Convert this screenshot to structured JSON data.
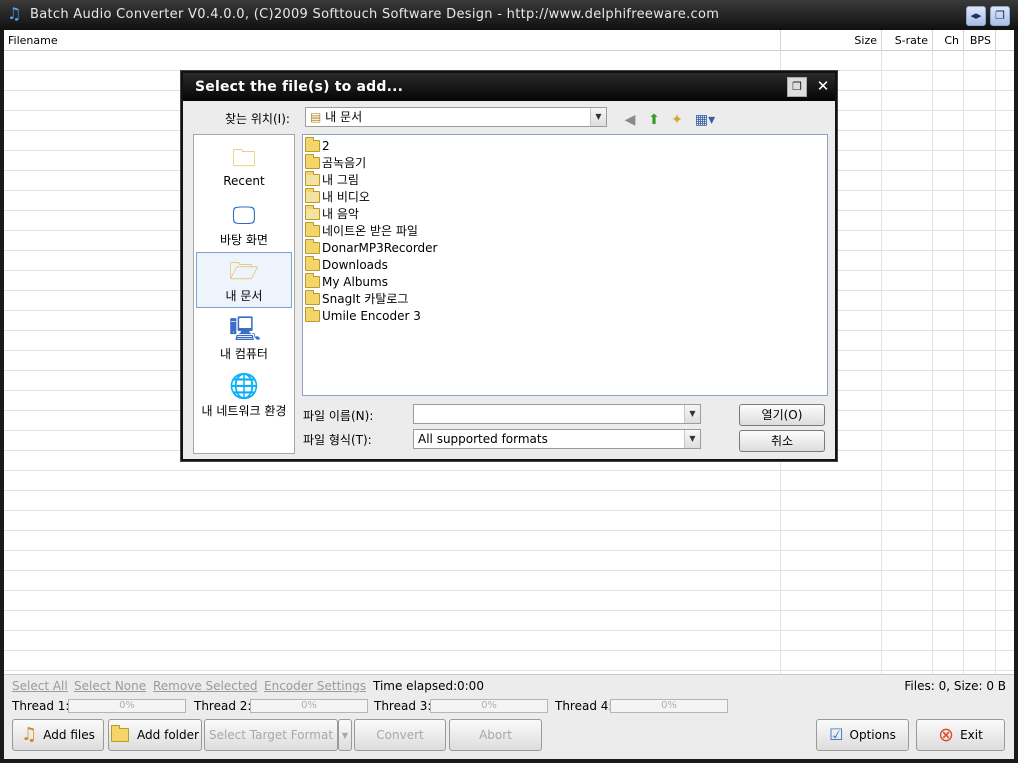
{
  "app": {
    "title": "Batch Audio Converter V0.4.0.0, (C)2009 Softtouch Software Design - http://www.delphifreeware.com",
    "icon": "music-note-icon"
  },
  "grid": {
    "columns": [
      "Filename",
      "Size",
      "S-rate",
      "Ch",
      "BPS"
    ]
  },
  "dialog": {
    "title": "Select the file(s) to add...",
    "lookin_label": "찾는 위치(I):",
    "lookin_value": "내 문서",
    "places": [
      "Recent",
      "바탕 화면",
      "내 문서",
      "내 컴퓨터",
      "내 네트워크 환경"
    ],
    "items": [
      "2",
      "곰녹음기",
      "내 그림",
      "내 비디오",
      "내 음악",
      "네이트온 받은 파일",
      "DonarMP3Recorder",
      "Downloads",
      "My Albums",
      "SnagIt 카탈로그",
      "Umile Encoder 3"
    ],
    "filename_label": "파일 이름(N):",
    "filename_value": "",
    "filetype_label": "파일 형식(T):",
    "filetype_value": "All supported formats",
    "open_label": "열기(O)",
    "cancel_label": "취소"
  },
  "bottom": {
    "links": [
      "Select All",
      "Select None",
      "Remove Selected",
      "Encoder Settings"
    ],
    "time_elapsed_label": "Time elapsed:",
    "time_elapsed_value": "0:00",
    "files_status": "Files: 0, Size: 0 B",
    "threads": [
      {
        "label": "Thread 1:",
        "progress": "0%"
      },
      {
        "label": "Thread 2:",
        "progress": "0%"
      },
      {
        "label": "Thread 3:",
        "progress": "0%"
      },
      {
        "label": "Thread 4:",
        "progress": "0%"
      }
    ],
    "buttons": {
      "add_files": "Add files",
      "add_folder": "Add folder",
      "select_target_format": "Select Target Format",
      "convert": "Convert",
      "abort": "Abort",
      "options": "Options",
      "exit": "Exit"
    }
  },
  "colors": {
    "titlebar": "#101010",
    "dialog_title": "#050505",
    "exit_icon": "#e04a2a",
    "folder": "#f4d56a"
  }
}
